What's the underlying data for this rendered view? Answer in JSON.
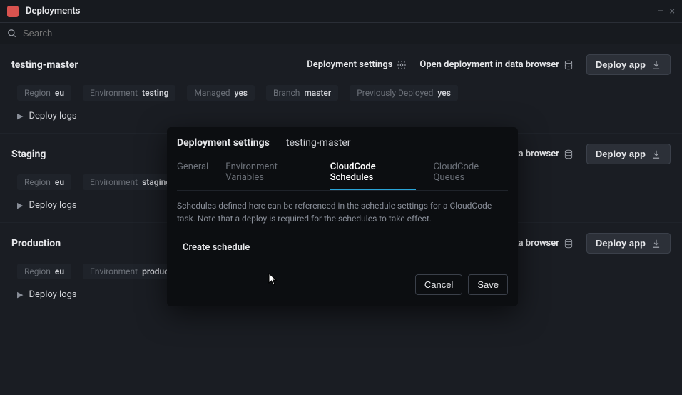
{
  "app": {
    "title": "Deployments"
  },
  "search": {
    "placeholder": "Search"
  },
  "sections": [
    {
      "title": "testing-master",
      "actions": {
        "settings": "Deployment settings",
        "open_browser": "Open deployment in data browser",
        "deploy": "Deploy app"
      },
      "tags": [
        {
          "key": "Region",
          "val": "eu"
        },
        {
          "key": "Environment",
          "val": "testing"
        },
        {
          "key": "Managed",
          "val": "yes"
        },
        {
          "key": "Branch",
          "val": "master"
        },
        {
          "key": "Previously Deployed",
          "val": "yes"
        }
      ],
      "logs_label": "Deploy logs"
    },
    {
      "title": "Staging",
      "actions": {
        "open_browser_suffix": "t in data browser",
        "deploy": "Deploy app"
      },
      "tags": [
        {
          "key": "Region",
          "val": "eu"
        },
        {
          "key": "Environment",
          "val": "staging"
        }
      ],
      "logs_label": "Deploy logs"
    },
    {
      "title": "Production",
      "actions": {
        "open_browser_suffix": "t in data browser",
        "deploy": "Deploy app"
      },
      "tags": [
        {
          "key": "Region",
          "val": "eu"
        },
        {
          "key": "Environment",
          "val": "production"
        }
      ],
      "logs_label": "Deploy logs"
    }
  ],
  "modal": {
    "title": "Deployment settings",
    "subtitle": "testing-master",
    "tabs": {
      "general": "General",
      "env": "Environment Variables",
      "schedules": "CloudCode Schedules",
      "queues": "CloudCode Queues"
    },
    "description": "Schedules defined here can be referenced in the schedule settings for a CloudCode task. Note that a deploy is required for the schedules to take effect.",
    "create_label": "Create schedule",
    "cancel": "Cancel",
    "save": "Save"
  }
}
